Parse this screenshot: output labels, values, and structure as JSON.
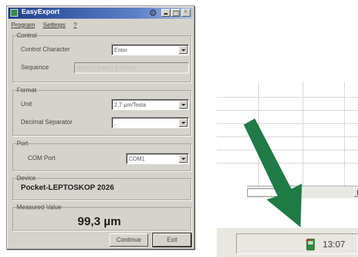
{
  "window": {
    "title": "EasyExport",
    "menu": [
      "Program",
      "Settings",
      "?"
    ]
  },
  "control": {
    "group_label": "Control",
    "control_character_label": "Control Character",
    "control_character_value": "Enter",
    "sequence_label": "Sequence",
    "sequence_placeholder": "[DIGIT] [UNIT] [ENTER]"
  },
  "format": {
    "group_label": "Format",
    "unit_label": "Unit",
    "unit_value": "2,7 µm/Tesla",
    "decimal_separator_label": "Decimal Separator",
    "decimal_separator_value": ","
  },
  "port": {
    "group_label": "Port",
    "com_port_label": "COM Port",
    "com_port_value": "COM1"
  },
  "device": {
    "group_label": "Device",
    "name": "Pocket-LEPTOSKOP 2026"
  },
  "measured": {
    "group_label": "Measured Value",
    "value": "99,3 µm"
  },
  "buttons": {
    "continue": "Continue",
    "exit": "Exit"
  },
  "taskbar": {
    "clock": "13:07"
  },
  "colors": {
    "arrow": "#1f7a46",
    "title_bar": "#1f3f8f"
  }
}
